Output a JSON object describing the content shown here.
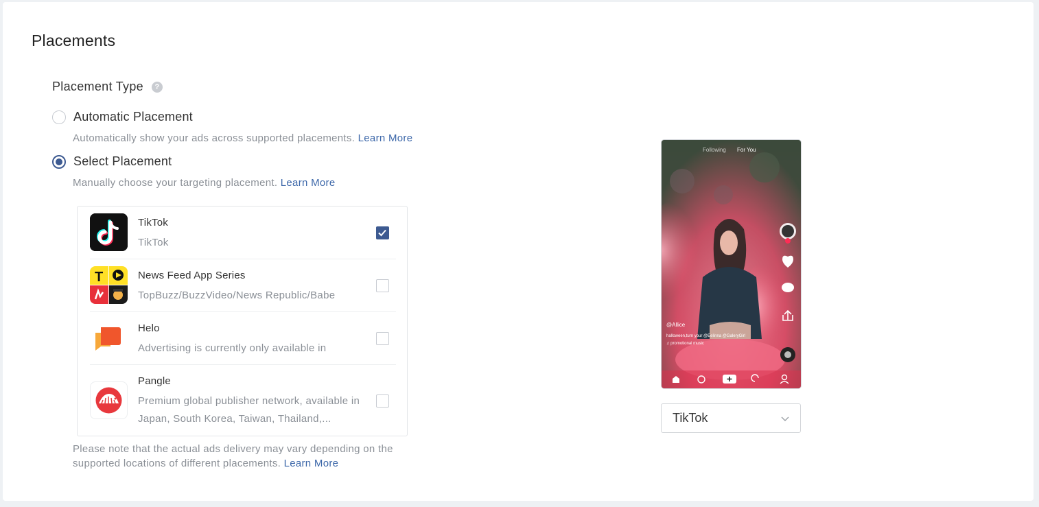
{
  "section": {
    "title": "Placements"
  },
  "placement_type": {
    "label": "Placement Type",
    "help_icon": "?"
  },
  "options": [
    {
      "label": "Automatic Placement",
      "description": "Automatically show your ads across supported placements.",
      "link": "Learn More",
      "selected": false
    },
    {
      "label": "Select Placement",
      "description": "Manually choose your targeting placement.",
      "link": "Learn More",
      "selected": true
    }
  ],
  "placements": [
    {
      "name": "TikTok",
      "subtitle": "TikTok",
      "checked": true,
      "icon": "tiktok-app-icon"
    },
    {
      "name": "News Feed App Series",
      "subtitle": "TopBuzz/BuzzVideo/News Republic/Babe",
      "checked": false,
      "icon": "news-feed-app-icon"
    },
    {
      "name": "Helo",
      "subtitle": "Advertising is currently only available in",
      "checked": false,
      "icon": "helo-app-icon"
    },
    {
      "name": "Pangle",
      "subtitle": "Premium global publisher network, available in Japan, South Korea, Taiwan, Thailand,...",
      "checked": false,
      "icon": "pangle-app-icon"
    }
  ],
  "note": {
    "text": "Please note that the actual ads delivery may vary depending on the supported locations of different placements.",
    "link": "Learn More"
  },
  "preview": {
    "tabs": [
      "Following",
      "For You"
    ],
    "username": "@Allice",
    "caption": "halloween,turn your @Eelinna @GaleryGirl",
    "music": "♫ promotional music",
    "select_value": "TikTok"
  },
  "colors": {
    "accent": "#3d5a91",
    "link": "#3c67a9",
    "muted": "#8a8f96"
  }
}
